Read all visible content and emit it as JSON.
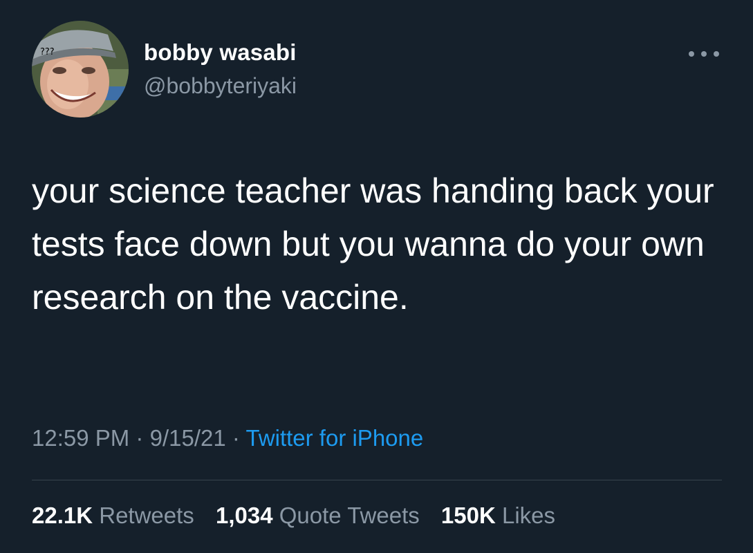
{
  "colors": {
    "background": "#15202b",
    "primary_text": "#ffffff",
    "secondary_text": "#8b98a5",
    "link": "#1d9bf0",
    "divider": "#38444d"
  },
  "author": {
    "display_name": "bobby wasabi",
    "handle": "@bobbyteriyaki",
    "avatar_caption": "???",
    "avatar_icon": "profile-photo"
  },
  "more_icon": "more-horizontal-icon",
  "tweet": {
    "text": "your science teacher was handing back your tests face down but you wanna do your own research on the vaccine."
  },
  "meta": {
    "time": "12:59 PM",
    "date": "9/15/21",
    "separator": "·",
    "source": "Twitter for iPhone"
  },
  "stats": [
    {
      "count": "22.1K",
      "label": "Retweets"
    },
    {
      "count": "1,034",
      "label": "Quote Tweets"
    },
    {
      "count": "150K",
      "label": "Likes"
    }
  ]
}
